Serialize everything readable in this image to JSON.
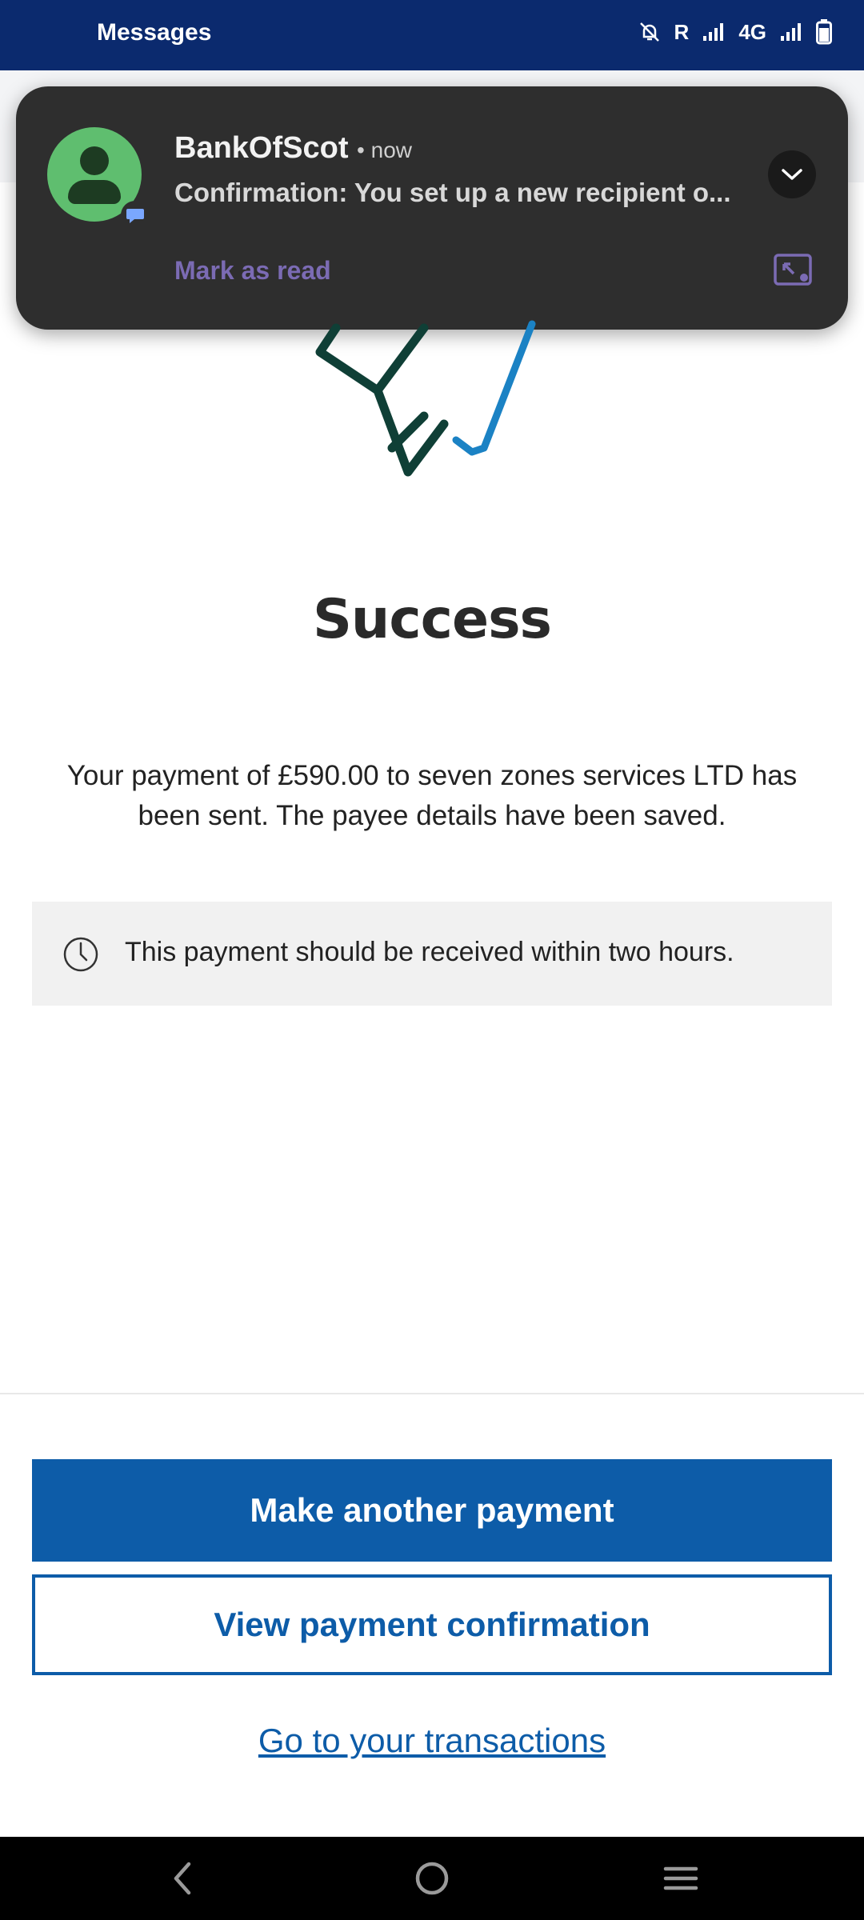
{
  "status_bar": {
    "app_title": "Messages",
    "indicators": [
      "bell-off-icon",
      "R",
      "signal-icon",
      "4G",
      "signal-icon",
      "battery-icon"
    ]
  },
  "notification": {
    "sender": "BankOfScot",
    "time": "• now",
    "message": "Confirmation: You set up a new recipient o...",
    "action": "Mark as read"
  },
  "main": {
    "title": "Success",
    "message": "Your payment of £590.00 to seven zones services LTD has been sent. The payee details have been saved.",
    "info": "This payment should be received within two hours."
  },
  "actions": {
    "primary": "Make another payment",
    "secondary": "View payment confirmation",
    "link": "Go to your transactions"
  },
  "colors": {
    "brand_blue": "#0d5ca8",
    "status_bar": "#0b2a6e",
    "notification_bg": "#2e2e2e",
    "avatar_green": "#5fbe6f"
  }
}
